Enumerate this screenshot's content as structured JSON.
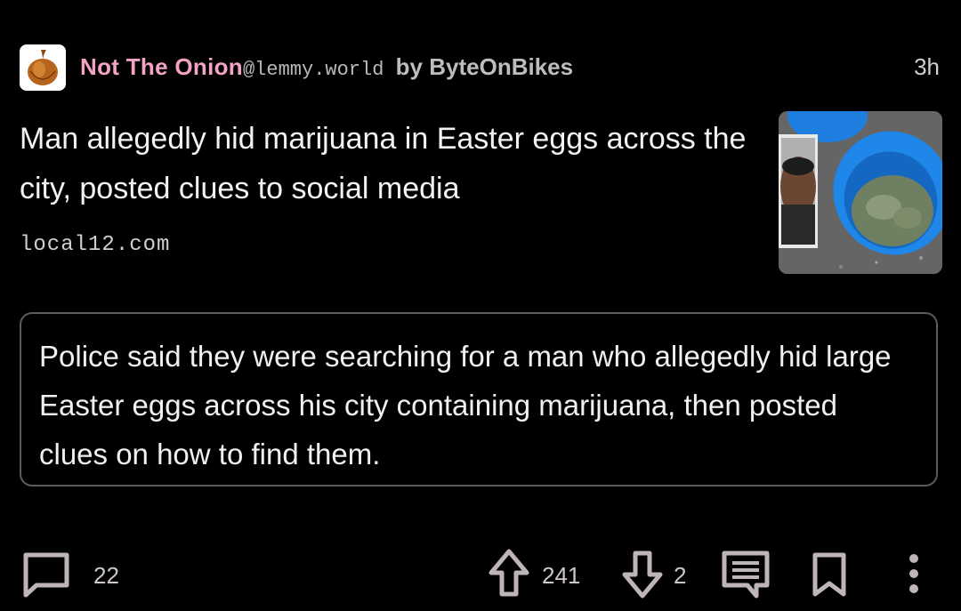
{
  "post": {
    "community": "Not The Onion",
    "instance": "@lemmy.world",
    "by": "by",
    "author": "ByteOnBikes",
    "age": "3h",
    "title": "Man allegedly hid marijuana in Easter eggs across the city, posted clues to social media",
    "domain": "local12.com",
    "body": "Police said they were searching for a man who allegedly hid large Easter eggs across his city containing marijuana, then posted clues on how to find them."
  },
  "actions": {
    "comments": "22",
    "upvotes": "241",
    "downvotes": "2"
  },
  "icons": {
    "comment": "comment-icon",
    "upvote": "arrow-up-icon",
    "downvote": "arrow-down-icon",
    "reply": "reply-icon",
    "save": "bookmark-icon",
    "more": "more-vertical-icon"
  },
  "colors": {
    "community": "#f3a3c4",
    "background": "#000000",
    "border": "#5f5a5c"
  }
}
